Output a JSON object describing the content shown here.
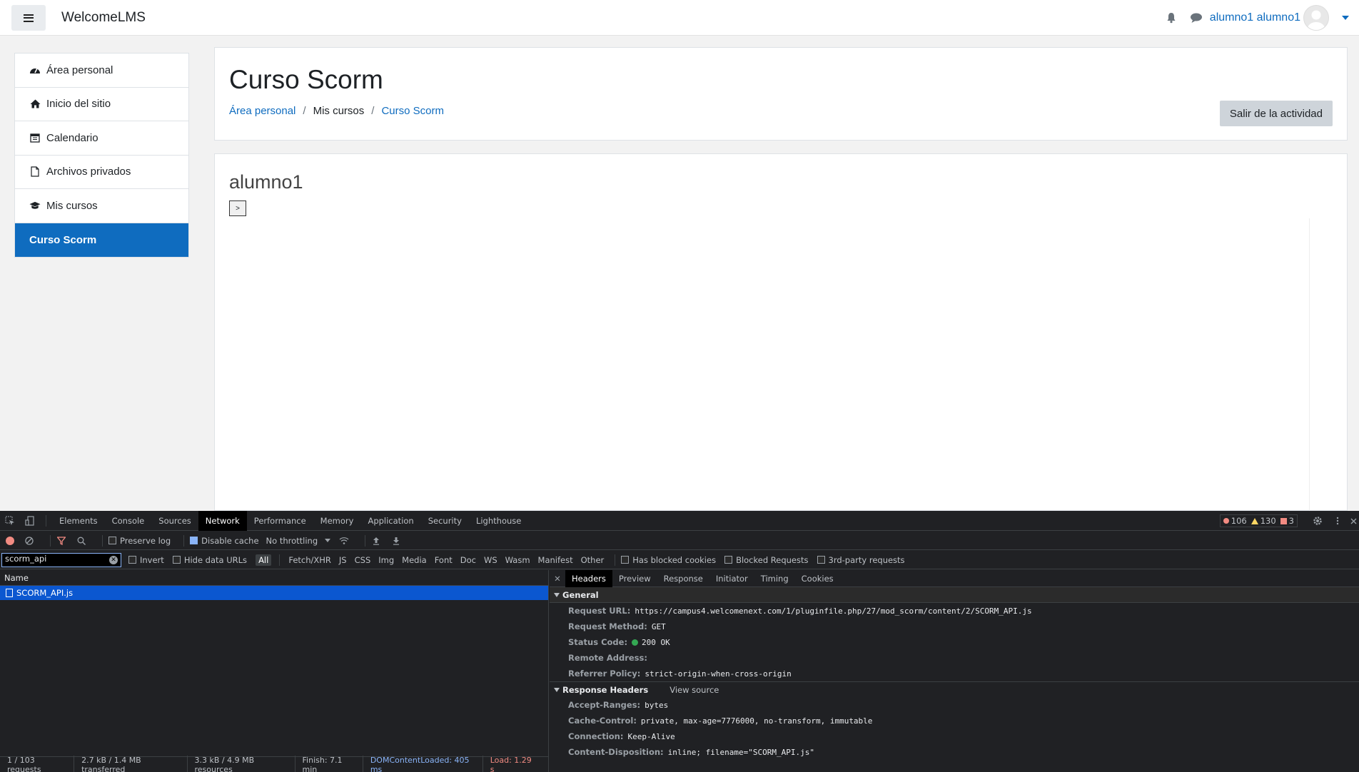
{
  "navbar": {
    "brand": "WelcomeLMS",
    "user_name": "alumno1 alumno1"
  },
  "drawer": {
    "items": [
      {
        "label": "Área personal",
        "icon": "dashboard-icon"
      },
      {
        "label": "Inicio del sitio",
        "icon": "home-icon"
      },
      {
        "label": "Calendario",
        "icon": "calendar-icon"
      },
      {
        "label": "Archivos privados",
        "icon": "file-icon"
      },
      {
        "label": "Mis cursos",
        "icon": "graduation-cap-icon"
      },
      {
        "label": "Curso Scorm",
        "icon": ""
      }
    ]
  },
  "header": {
    "title": "Curso Scorm",
    "breadcrumb": [
      "Área personal",
      "Mis cursos",
      "Curso Scorm"
    ],
    "exit_button": "Salir de la actividad"
  },
  "content": {
    "student_name": "alumno1",
    "nav_button": ">"
  },
  "devtools": {
    "tabs": [
      "Elements",
      "Console",
      "Sources",
      "Network",
      "Performance",
      "Memory",
      "Application",
      "Security",
      "Lighthouse"
    ],
    "active_tab": "Network",
    "errors": "106",
    "warnings": "130",
    "issues": "3",
    "toolbar": {
      "preserve_log": "Preserve log",
      "disable_cache": "Disable cache",
      "throttling": "No throttling"
    },
    "filter": {
      "value": "scorm_api",
      "invert": "Invert",
      "hide_data_urls": "Hide data URLs",
      "types": [
        "All",
        "Fetch/XHR",
        "JS",
        "CSS",
        "Img",
        "Media",
        "Font",
        "Doc",
        "WS",
        "Wasm",
        "Manifest",
        "Other"
      ],
      "has_blocked_cookies": "Has blocked cookies",
      "blocked_requests": "Blocked Requests",
      "third_party": "3rd-party requests"
    },
    "requests": {
      "column": "Name",
      "rows": [
        "SCORM_API.js"
      ]
    },
    "status": {
      "requests": "1 / 103 requests",
      "transferred": "2.7 kB / 1.4 MB transferred",
      "resources": "3.3 kB / 4.9 MB resources",
      "finish": "Finish: 7.1 min",
      "dcl": "DOMContentLoaded: 405 ms",
      "load": "Load: 1.29 s"
    },
    "details": {
      "tabs": [
        "Headers",
        "Preview",
        "Response",
        "Initiator",
        "Timing",
        "Cookies"
      ],
      "general_title": "General",
      "general": [
        {
          "k": "Request URL:",
          "v": "https://campus4.welcomenext.com/1/pluginfile.php/27/mod_scorm/content/2/SCORM_API.js"
        },
        {
          "k": "Request Method:",
          "v": "GET"
        },
        {
          "k": "Status Code:",
          "v": "200 OK"
        },
        {
          "k": "Remote Address:",
          "v": ""
        },
        {
          "k": "Referrer Policy:",
          "v": "strict-origin-when-cross-origin"
        }
      ],
      "response_title": "Response Headers",
      "view_source": "View source",
      "response": [
        {
          "k": "Accept-Ranges:",
          "v": "bytes"
        },
        {
          "k": "Cache-Control:",
          "v": "private, max-age=7776000, no-transform, immutable"
        },
        {
          "k": "Connection:",
          "v": "Keep-Alive"
        },
        {
          "k": "Content-Disposition:",
          "v": "inline; filename=\"SCORM_API.js\""
        }
      ]
    }
  }
}
